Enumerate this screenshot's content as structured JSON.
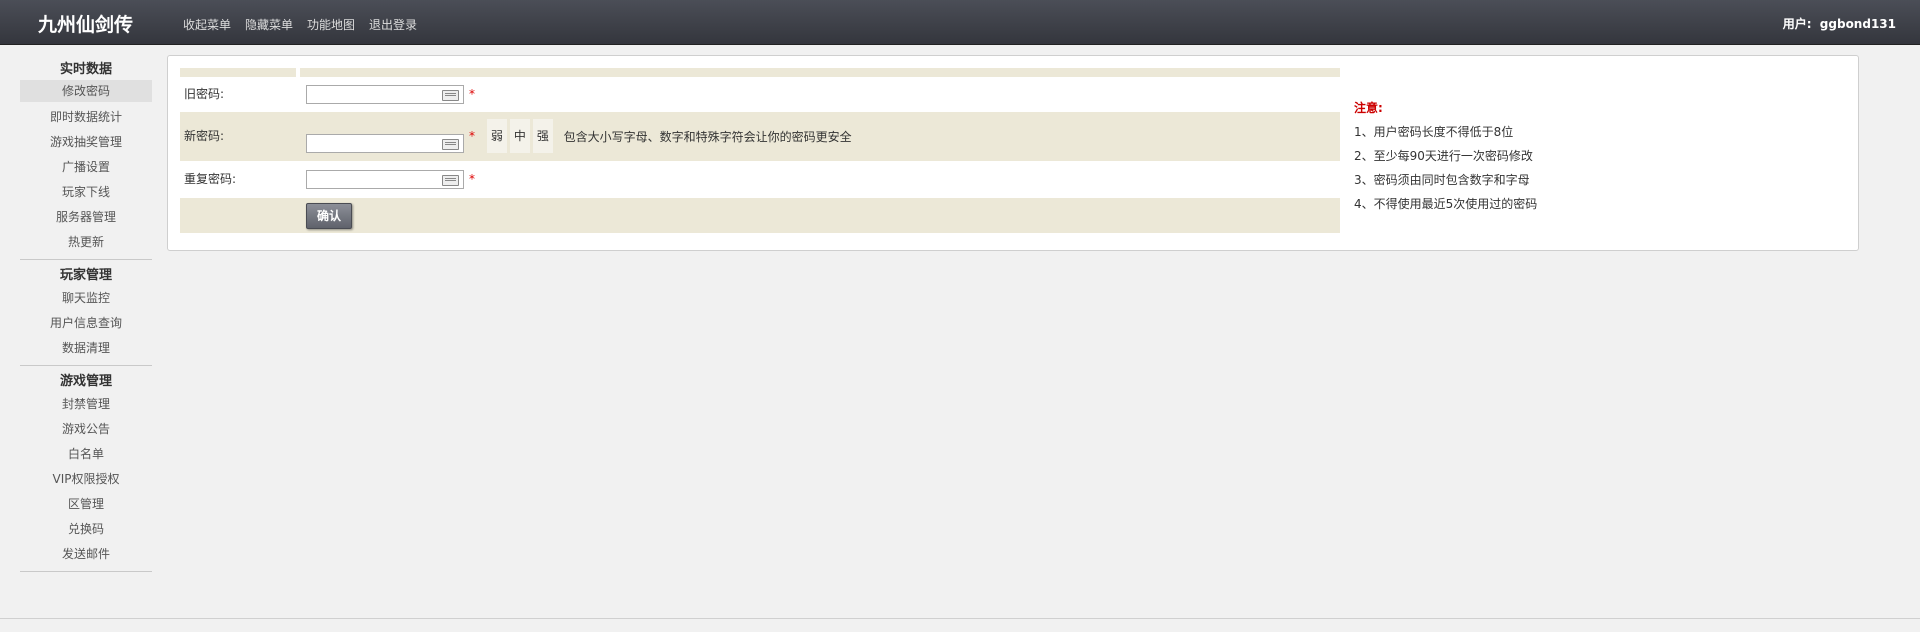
{
  "header": {
    "logo": "九州仙剑传",
    "nav": [
      "收起菜单",
      "隐藏菜单",
      "功能地图",
      "退出登录"
    ],
    "user_label": "用户:",
    "user_name": "ggbond131"
  },
  "sidebar": {
    "groups": [
      {
        "title": "实时数据",
        "items": [
          "修改密码",
          "即时数据统计",
          "游戏抽奖管理",
          "广播设置",
          "玩家下线",
          "服务器管理",
          "热更新"
        ]
      },
      {
        "title": "玩家管理",
        "items": [
          "聊天监控",
          "用户信息查询",
          "数据清理"
        ]
      },
      {
        "title": "游戏管理",
        "items": [
          "封禁管理",
          "游戏公告",
          "白名单",
          "VIP权限授权",
          "区管理",
          "兑换码",
          "发送邮件"
        ]
      }
    ],
    "active_item": "修改密码"
  },
  "form": {
    "old_password_label": "旧密码:",
    "new_password_label": "新密码:",
    "repeat_password_label": "重复密码:",
    "required_mark": "*",
    "old_password_value": "",
    "new_password_value": "",
    "repeat_password_value": "",
    "strength": [
      "弱",
      "中",
      "强"
    ],
    "hint": "包含大小写字母、数字和特殊字符会让你的密码更安全",
    "submit_label": "确认"
  },
  "notes": {
    "title": "注意:",
    "items": [
      "1、用户密码长度不得低于8位",
      "2、至少每90天进行一次密码修改",
      "3、密码须由同时包含数字和字母",
      "4、不得使用最近5次使用过的密码"
    ]
  },
  "colors": {
    "header_bg": "#3d4047",
    "row_beige": "#ece8d7",
    "note_red": "#cc0000",
    "required_red": "#dd0000"
  }
}
